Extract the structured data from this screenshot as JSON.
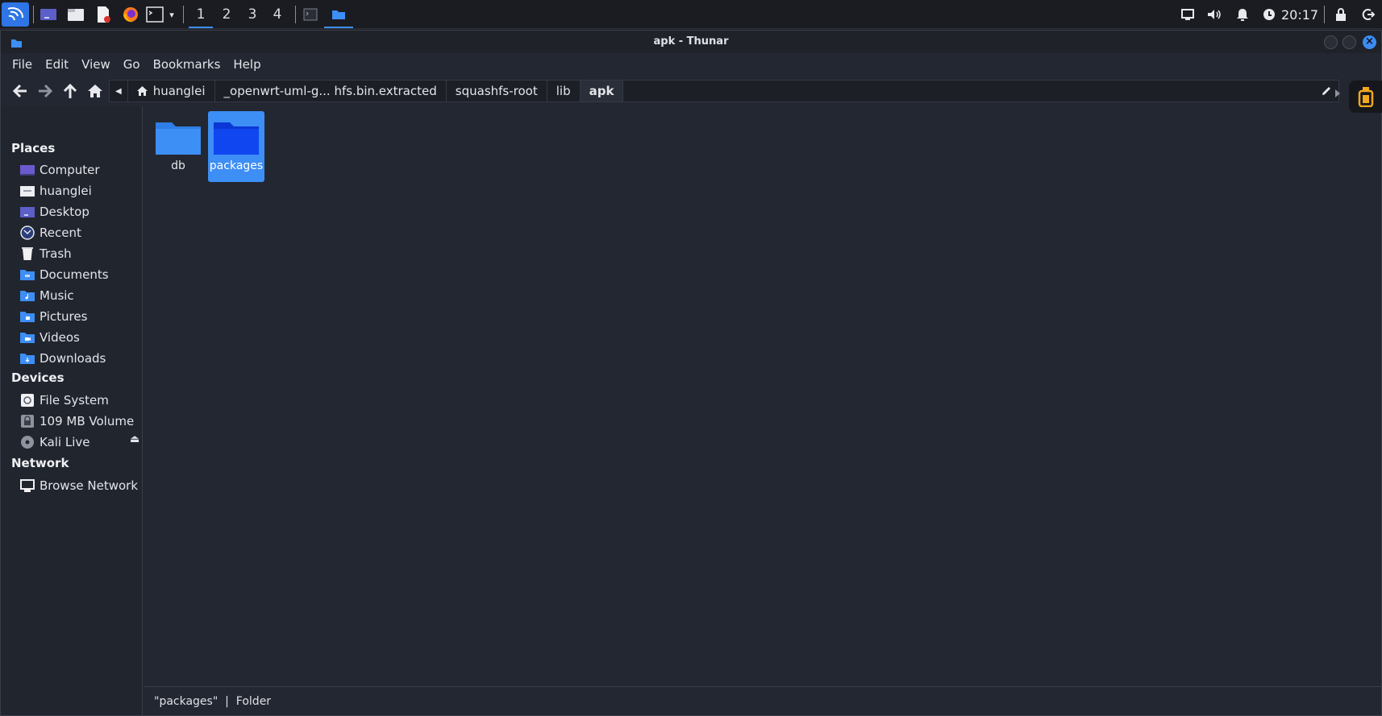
{
  "panel": {
    "workspaces": [
      "1",
      "2",
      "3",
      "4"
    ],
    "active_workspace": "1",
    "clock": "20:17"
  },
  "window": {
    "title": "apk - Thunar"
  },
  "menubar": [
    "File",
    "Edit",
    "View",
    "Go",
    "Bookmarks",
    "Help"
  ],
  "pathbar": {
    "crumbs": [
      "huanglei",
      "_openwrt-uml-g... hfs.bin.extracted",
      "squashfs-root",
      "lib",
      "apk"
    ],
    "active_crumb": "apk"
  },
  "sidebar": {
    "places_title": "Places",
    "places": [
      {
        "label": "Computer",
        "icon": "computer-icon"
      },
      {
        "label": "huanglei",
        "icon": "home-folder-icon"
      },
      {
        "label": "Desktop",
        "icon": "desktop-icon"
      },
      {
        "label": "Recent",
        "icon": "recent-icon"
      },
      {
        "label": "Trash",
        "icon": "trash-icon"
      },
      {
        "label": "Documents",
        "icon": "documents-folder-icon"
      },
      {
        "label": "Music",
        "icon": "music-folder-icon"
      },
      {
        "label": "Pictures",
        "icon": "pictures-folder-icon"
      },
      {
        "label": "Videos",
        "icon": "videos-folder-icon"
      },
      {
        "label": "Downloads",
        "icon": "downloads-folder-icon"
      }
    ],
    "devices_title": "Devices",
    "devices": [
      {
        "label": "File System",
        "icon": "harddisk-icon"
      },
      {
        "label": "109 MB Volume",
        "icon": "volume-icon"
      },
      {
        "label": "Kali Live",
        "icon": "optical-disc-icon"
      }
    ],
    "network_title": "Network",
    "network": [
      {
        "label": "Browse Network",
        "icon": "network-icon"
      }
    ]
  },
  "files": [
    {
      "name": "db",
      "icon": "folder-icon",
      "selected": false
    },
    {
      "name": "packages",
      "icon": "folder-icon",
      "selected": true
    }
  ],
  "status": {
    "text": "\"packages\"  |  Folder"
  },
  "colors": {
    "accent": "#3d8ef5",
    "background": "#232731",
    "panel": "#1b1c21"
  }
}
